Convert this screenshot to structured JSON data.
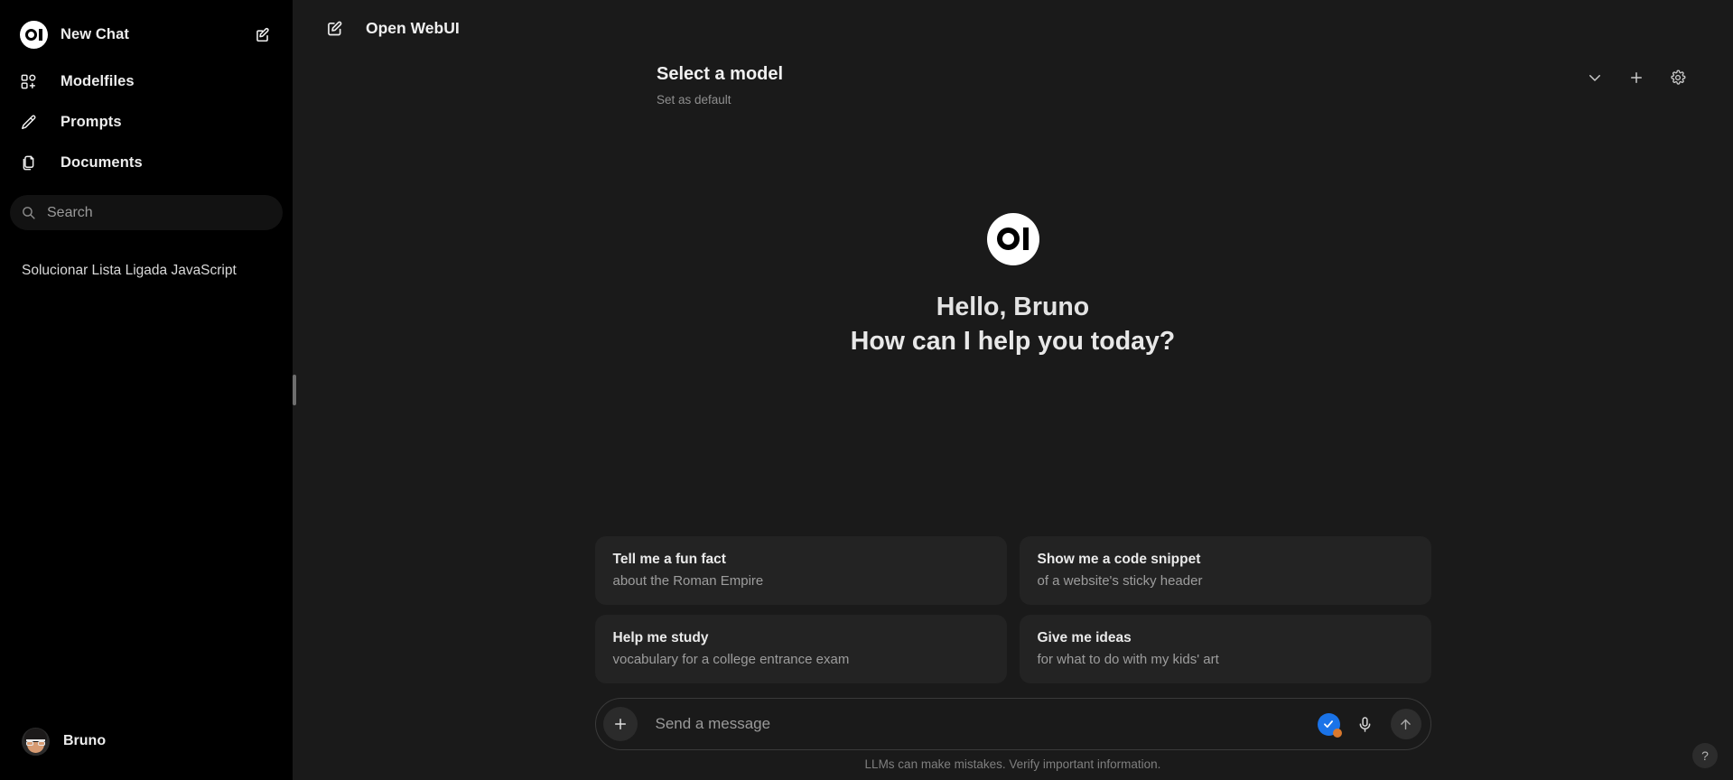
{
  "sidebar": {
    "new_chat": {
      "label": "New Chat",
      "logo_icon": "openwebui-logo-icon",
      "edit_icon": "new-chat-edit-icon"
    },
    "nav_items": [
      {
        "label": "Modelfiles",
        "icon": "modelfiles-icon"
      },
      {
        "label": "Prompts",
        "icon": "prompts-pencil-icon"
      },
      {
        "label": "Documents",
        "icon": "documents-copy-icon"
      }
    ],
    "search": {
      "placeholder": "Search",
      "value": "",
      "icon": "search-icon"
    },
    "chats": [
      {
        "title": "Solucionar Lista Ligada JavaScript"
      }
    ],
    "user": {
      "name": "Bruno",
      "avatar_icon": "user-avatar"
    }
  },
  "header": {
    "title": "Open WebUI",
    "edit_icon": "new-chat-edit-icon"
  },
  "model_bar": {
    "select_label": "Select a model",
    "set_default_label": "Set as default",
    "actions": [
      {
        "name": "chevron-down-icon",
        "label": ""
      },
      {
        "name": "plus-icon",
        "label": ""
      },
      {
        "name": "gear-icon",
        "label": ""
      }
    ]
  },
  "hero": {
    "logo_icon": "openwebui-logo-icon",
    "greeting": "Hello, Bruno",
    "question": "How can I help you today?"
  },
  "suggestions": [
    {
      "title": "Tell me a fun fact",
      "subtitle": "about the Roman Empire"
    },
    {
      "title": "Show me a code snippet",
      "subtitle": "of a website's sticky header"
    },
    {
      "title": "Help me study",
      "subtitle": "vocabulary for a college entrance exam"
    },
    {
      "title": "Give me ideas",
      "subtitle": "for what to do with my kids' art"
    }
  ],
  "composer": {
    "placeholder": "Send a message",
    "value": "",
    "plus_icon": "plus-icon",
    "check_badge_icon": "password-manager-check-icon",
    "mic_icon": "microphone-icon",
    "send_icon": "send-arrow-up-icon"
  },
  "footer": {
    "disclaimer": "LLMs can make mistakes. Verify important information.",
    "help_label": "?"
  },
  "colors": {
    "sidebar_bg": "#000000",
    "main_bg": "#1a1a1a",
    "card_bg": "#232323",
    "accent_blue": "#1a73e8",
    "accent_orange": "#d9792e"
  }
}
